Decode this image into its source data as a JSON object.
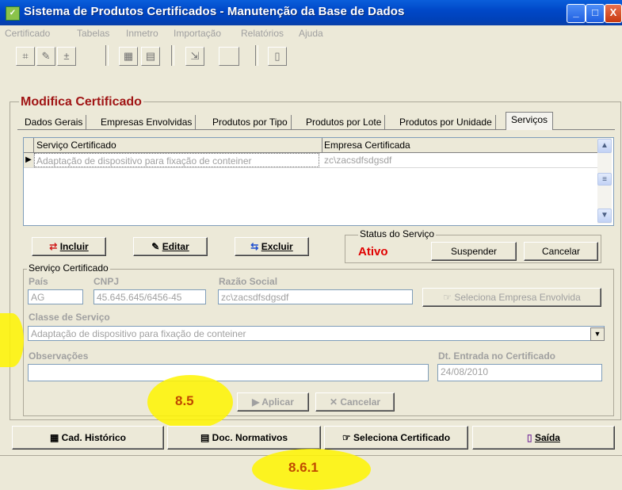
{
  "window": {
    "title": "Sistema de Produtos Certificados - Manutenção da Base de Dados"
  },
  "menu": [
    "Certificado",
    "Tabelas",
    "Inmetro",
    "Importação",
    "Relatórios",
    "Ajuda"
  ],
  "group": {
    "title": "Modifica Certificado"
  },
  "tabs": [
    "Dados Gerais",
    "Empresas Envolvidas",
    "Produtos por Tipo",
    "Produtos por Lote",
    "Produtos por Unidade",
    "Serviços"
  ],
  "grid": {
    "columns": [
      "Serviço Certificado",
      "Empresa Certificada"
    ],
    "rows": [
      {
        "servico": "Adaptação de dispositivo para fixação de conteiner",
        "empresa": "zc\\zacsdfsdgsdf"
      }
    ]
  },
  "actions": {
    "incluir": "Incluir",
    "editar": "Editar",
    "excluir": "Excluir"
  },
  "status": {
    "frame_title": "Status do Serviço",
    "value": "Ativo",
    "suspender": "Suspender",
    "cancelar": "Cancelar"
  },
  "servico": {
    "frame_title": "Serviço Certificado",
    "pais_label": "País",
    "pais": "AG",
    "cnpj_label": "CNPJ",
    "cnpj": "45.645.645/6456-45",
    "razao_label": "Razão Social",
    "razao": "zc\\zacsdfsdgsdf",
    "seleciona_empresa": "Seleciona Empresa Envolvida",
    "classe_label": "Classe de Serviço",
    "classe": "Adaptação de dispositivo para fixação de conteiner",
    "obs_label": "Observações",
    "obs": "",
    "data_label": "Dt. Entrada no Certificado",
    "data": "24/08/2010",
    "aplicar": "Aplicar",
    "cancelar": "Cancelar"
  },
  "bottom": {
    "historico": "Cad. Histórico",
    "normativos": "Doc. Normativos",
    "seleciona": "Seleciona Certificado",
    "saida": "Saída"
  },
  "annotations": {
    "a1": "8.5",
    "a2": "8.6.1"
  },
  "colors": {
    "title_bar": "#0048C8",
    "group_title": "#A01515",
    "status_active": "#E00000",
    "highlight": "#FFF500"
  }
}
